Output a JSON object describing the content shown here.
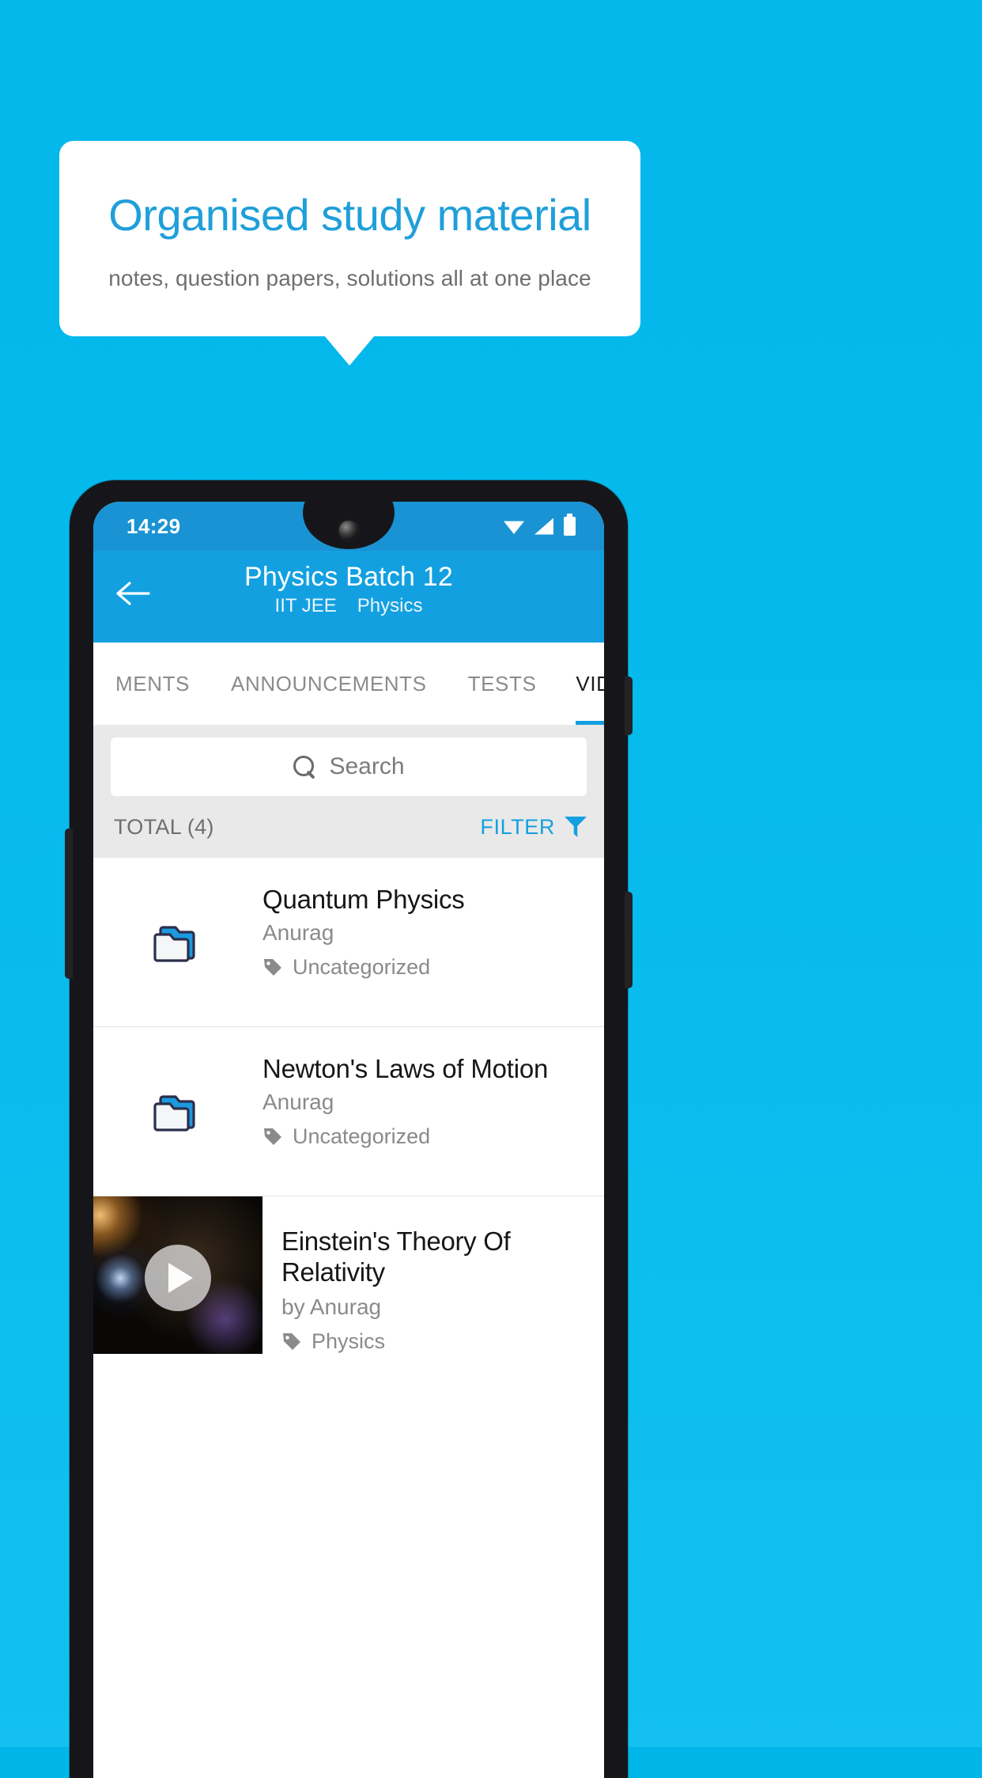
{
  "promo": {
    "title": "Organised study material",
    "subtitle": "notes, question papers, solutions all at one place",
    "accent_color": "#1f9fd9",
    "background_color": "#04b8eb"
  },
  "phone": {
    "status_bar": {
      "time": "14:29",
      "icons": [
        "wifi-icon",
        "signal-icon",
        "battery-icon"
      ],
      "background_color": "#1a93d4"
    },
    "app_bar": {
      "back_icon": "back-arrow-icon",
      "title": "Physics Batch 12",
      "subtitle_exam": "IIT JEE",
      "subtitle_subject": "Physics",
      "background_color": "#13a0e0"
    },
    "tabs": [
      {
        "label": "MENTS",
        "active": false
      },
      {
        "label": "ANNOUNCEMENTS",
        "active": false
      },
      {
        "label": "TESTS",
        "active": false
      },
      {
        "label": "VIDEOS",
        "active": true
      }
    ],
    "search": {
      "placeholder": "Search",
      "value": "",
      "icon": "search-icon"
    },
    "list_header": {
      "total_label": "TOTAL (4)",
      "filter_label": "FILTER",
      "filter_icon": "filter-icon"
    },
    "items": [
      {
        "kind": "folder",
        "icon": "folder-icon",
        "title": "Quantum Physics",
        "author": "Anurag",
        "tag": "Uncategorized",
        "tag_icon": "tag-icon"
      },
      {
        "kind": "folder",
        "icon": "folder-icon",
        "title": "Newton's Laws of Motion",
        "author": "Anurag",
        "tag": "Uncategorized",
        "tag_icon": "tag-icon"
      },
      {
        "kind": "video",
        "icon": "play-icon",
        "title": "Einstein's Theory Of Relativity",
        "author": "by Anurag",
        "tag": "Physics",
        "tag_icon": "tag-icon"
      }
    ]
  }
}
